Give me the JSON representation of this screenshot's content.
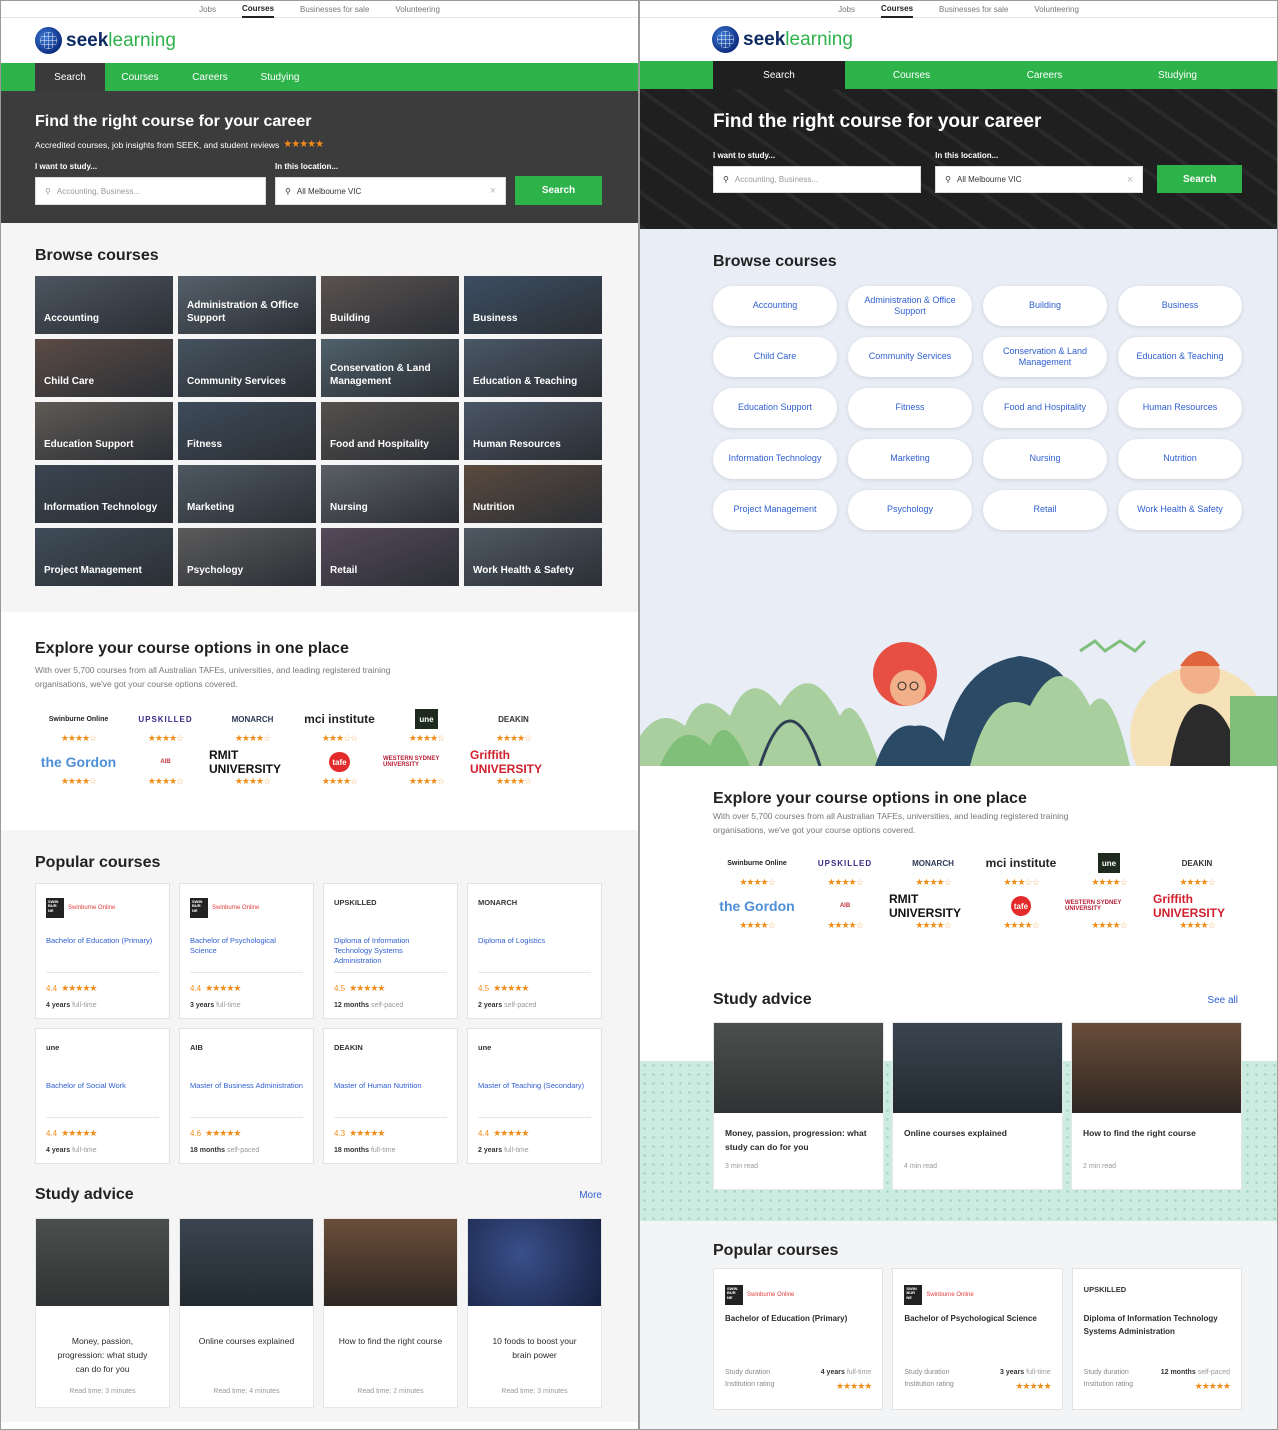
{
  "topnav": [
    "Jobs",
    "Courses",
    "Businesses for sale",
    "Volunteering"
  ],
  "topnav_active": "Courses",
  "logo": {
    "seek": "seek",
    "learning": "learning"
  },
  "mainnav": [
    "Search",
    "Courses",
    "Careers",
    "Studying"
  ],
  "mainnav_active": "Search",
  "hero": {
    "title": "Find the right course for your career",
    "subtitle": "Accredited courses, job insights from SEEK, and student reviews",
    "study_label": "I want to study...",
    "study_placeholder": "Accounting, Business...",
    "location_label": "In this location...",
    "location_value": "All Melbourne VIC",
    "search_button": "Search"
  },
  "browse": {
    "title": "Browse courses",
    "categories": [
      "Accounting",
      "Administration & Office Support",
      "Building",
      "Business",
      "Child Care",
      "Community Services",
      "Conservation & Land Management",
      "Education & Teaching",
      "Education Support",
      "Fitness",
      "Food and Hospitality",
      "Human Resources",
      "Information Technology",
      "Marketing",
      "Nursing",
      "Nutrition",
      "Project Management",
      "Psychology",
      "Retail",
      "Work Health & Safety"
    ],
    "right_categories": [
      "Accounting",
      "Administration & Office Support",
      "Building",
      "Business",
      "Child Care",
      "Community Services",
      "Conservation & Land Management",
      "Education & Teaching",
      "Education Support",
      "Fitness",
      "Food and Hospitality",
      "Human Resources",
      "Information Technology",
      "Marketing",
      "Nursing",
      "Nutrition",
      "Project Management",
      "Psychology",
      "Retail",
      "Work Health & Safety"
    ]
  },
  "explore": {
    "title": "Explore your course options in one place",
    "description": "With over 5,700 courses from all Australian TAFEs, universities, and leading registered training organisations, we've got your course options covered.",
    "providers": [
      {
        "name": "Swinburne Online",
        "rating": 4.5
      },
      {
        "name": "UPSKILLED",
        "rating": 4.5
      },
      {
        "name": "MONARCH",
        "rating": 4.5
      },
      {
        "name": "mci institute",
        "rating": 3.5
      },
      {
        "name": "une",
        "rating": 4.5
      },
      {
        "name": "DEAKIN",
        "rating": 4.5
      },
      {
        "name": "the Gordon",
        "rating": 4.5
      },
      {
        "name": "AIB",
        "rating": 4.5
      },
      {
        "name": "RMIT UNIVERSITY",
        "rating": 4
      },
      {
        "name": "tafe",
        "rating": 4.5
      },
      {
        "name": "WESTERN SYDNEY UNIVERSITY",
        "rating": 4
      },
      {
        "name": "Griffith UNIVERSITY",
        "rating": 4
      }
    ]
  },
  "popular": {
    "title": "Popular courses",
    "courses": [
      {
        "logo": "Swinburne Online",
        "title": "Bachelor of Education (Primary)",
        "rating": "4.4",
        "dur": "4 years",
        "mode": "full-time"
      },
      {
        "logo": "Swinburne Online",
        "title": "Bachelor of Psychological Science",
        "rating": "4.4",
        "dur": "3 years",
        "mode": "full-time"
      },
      {
        "logo": "UPSKILLED",
        "title": "Diploma of Information Technology Systems Administration",
        "rating": "4.5",
        "dur": "12 months",
        "mode": "self-paced"
      },
      {
        "logo": "MONARCH",
        "title": "Diploma of Logistics",
        "rating": "4.5",
        "dur": "2 years",
        "mode": "self-paced"
      },
      {
        "logo": "une",
        "title": "Bachelor of Social Work",
        "rating": "4.4",
        "dur": "4 years",
        "mode": "full-time"
      },
      {
        "logo": "AIB",
        "title": "Master of Business Administration",
        "rating": "4.6",
        "dur": "18 months",
        "mode": "self-paced"
      },
      {
        "logo": "DEAKIN",
        "title": "Master of Human Nutrition",
        "rating": "4.3",
        "dur": "18 months",
        "mode": "full-time"
      },
      {
        "logo": "une",
        "title": "Master of Teaching (Secondary)",
        "rating": "4.4",
        "dur": "2 years",
        "mode": "full-time"
      }
    ],
    "right_labels": {
      "duration": "Study duration",
      "rating": "Institution rating"
    }
  },
  "advice": {
    "title": "Study advice",
    "more": "More",
    "see_all": "See all",
    "articles": [
      {
        "title": "Money, passion, progression: what study can do for you",
        "read": "Read time: 3 minutes",
        "short": "3 min read"
      },
      {
        "title": "Online courses explained",
        "read": "Read time: 4 minutes",
        "short": "4 min read"
      },
      {
        "title": "How to find the right course",
        "read": "Read time: 2 minutes",
        "short": "2 min read"
      },
      {
        "title": "10 foods to boost your brain power",
        "read": "Read time: 3 minutes"
      }
    ]
  },
  "colors": {
    "green": "#2eb24a",
    "navy": "#0d2b62",
    "link": "#2f5fd0",
    "star": "#f28c18"
  }
}
